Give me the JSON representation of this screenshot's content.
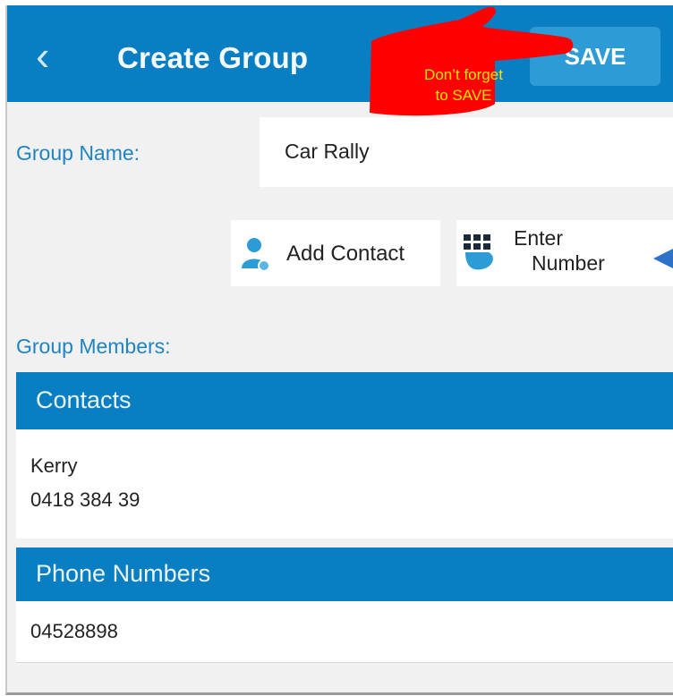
{
  "topbar": {
    "title": "Create Group",
    "back_icon": "chevron-left-icon",
    "save_label": "SAVE",
    "color": "#0a7ec2"
  },
  "annotation": {
    "line1": "Don’t forget",
    "line2": "to SAVE",
    "bubble_color": "#ff0000",
    "text_color": "#ffe200"
  },
  "form": {
    "group_name_label": "Group Name:",
    "group_name_value": "Car Rally",
    "add_contact_label": "Add Contact",
    "enter_number_line1": "Enter",
    "enter_number_line2": "Number",
    "group_members_label": "Group Members:"
  },
  "contacts": {
    "header": "Contacts",
    "items": [
      {
        "name": "Kerry",
        "number": "0418 384 39"
      }
    ]
  },
  "phone_numbers": {
    "header": "Phone Numbers",
    "items": [
      "04528898"
    ]
  }
}
